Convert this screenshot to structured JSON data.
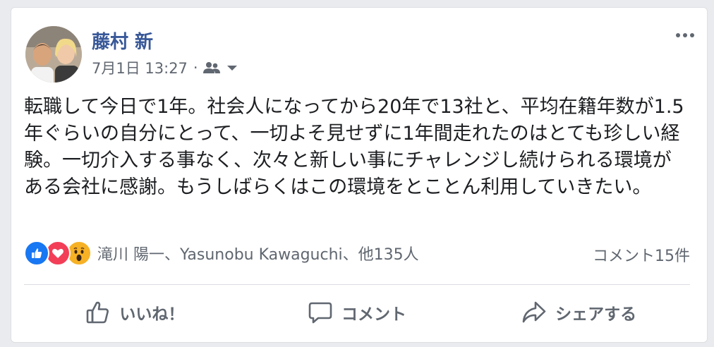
{
  "post": {
    "author": "藤村 新",
    "timestamp": "7月1日 13:27",
    "separator": "·",
    "audience_icon": "friends-icon",
    "text": "転職して今日で1年。社会人になってから20年で13社と、平均在籍年数が1.5年ぐらいの自分にとって、一切よそ見せずに1年間走れたのはとても珍しい経験。一切介入する事なく、次々と新しい事にチャレンジし続けられる環境がある会社に感謝。もうしばらくはこの環境をとことん利用していきたい。"
  },
  "reactions": {
    "types": [
      "like",
      "love",
      "wow"
    ],
    "summary": "滝川 陽一、Yasunobu Kawaguchi、他135人",
    "comments": "コメント15件"
  },
  "actions": {
    "like": "いいね！",
    "comment": "コメント",
    "share": "シェアする"
  },
  "colors": {
    "author": "#385898",
    "secondary_text": "#606770",
    "like_blue": "#1877f2",
    "love_red": "#f33e58",
    "wow_yellow": "#f7b125"
  }
}
